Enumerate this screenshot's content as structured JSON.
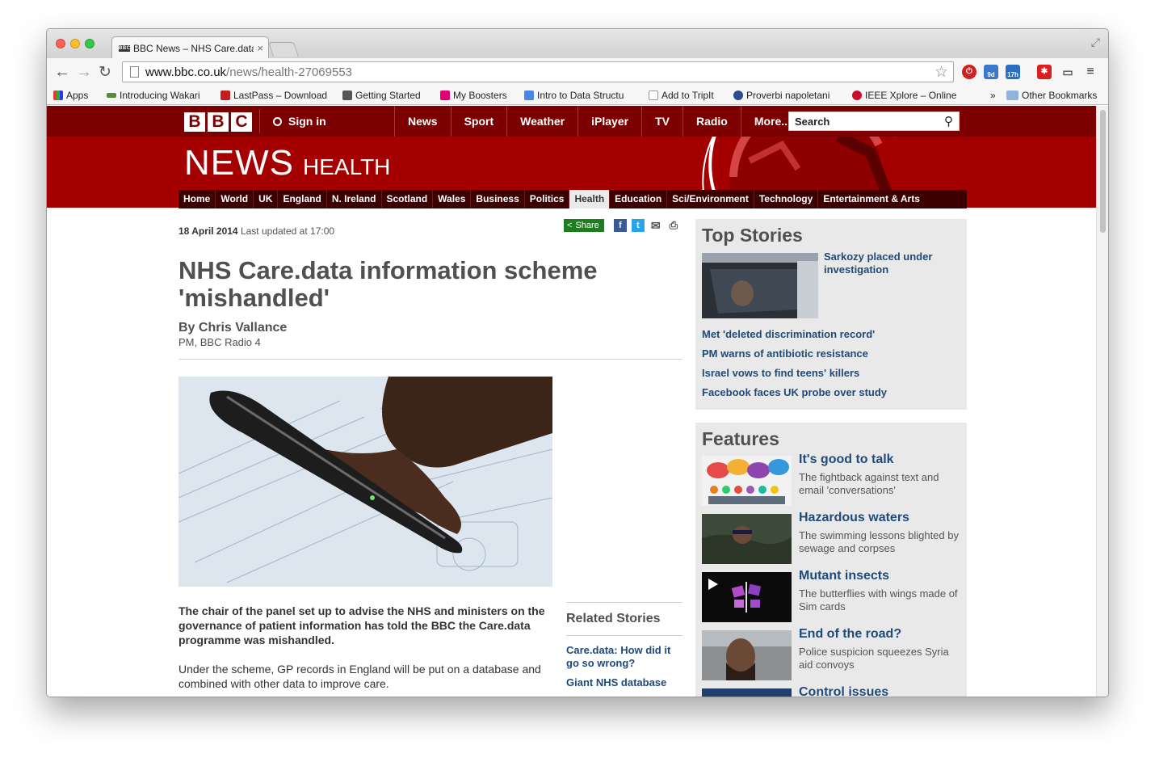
{
  "browser": {
    "tab_title": "BBC News – NHS Care.data",
    "url_host": "www.bbc.co.uk",
    "url_path": "/news/health-27069553",
    "bookmarks": [
      "Apps",
      "Introducing Wakari",
      "LastPass – Download",
      "Getting Started",
      "My Boosters",
      "Intro to Data Structu",
      "Add to TripIt",
      "Proverbi napoletani",
      "IEEE Xplore – Online"
    ],
    "overflow": "»",
    "other_bookmarks": "Other Bookmarks",
    "ext_badges": [
      "9d",
      "17h"
    ]
  },
  "bbc": {
    "sign_in": "Sign in",
    "top_nav": [
      "News",
      "Sport",
      "Weather",
      "iPlayer",
      "TV",
      "Radio",
      "More..."
    ],
    "search_placeholder": "Search",
    "masthead": "NEWS",
    "section": "HEALTH",
    "sub_nav": [
      "Home",
      "World",
      "UK",
      "England",
      "N. Ireland",
      "Scotland",
      "Wales",
      "Business",
      "Politics",
      "Health",
      "Education",
      "Sci/Environment",
      "Technology",
      "Entertainment & Arts"
    ],
    "active_section": "Health"
  },
  "article": {
    "date": "18 April 2014",
    "updated": "Last updated at 17:00",
    "share_label": "Share",
    "headline": "NHS Care.data information scheme 'mishandled'",
    "byline": "By Chris Vallance",
    "role": "PM, BBC Radio 4",
    "lead": "The chair of the panel set up to advise the NHS and ministers on the governance of patient information has told the BBC the Care.data programme was mishandled.",
    "para1": "Under the scheme, GP records in England will be put on a database and combined with other data to improve care."
  },
  "related": {
    "title": "Related Stories",
    "links": [
      "Care.data: How did it go so wrong?",
      "Giant NHS database"
    ]
  },
  "top_stories": {
    "title": "Top Stories",
    "lead": "Sarkozy placed under investigation",
    "links": [
      "Met 'deleted discrimination record'",
      "PM warns of antibiotic resistance",
      "Israel vows to find teens' killers",
      "Facebook faces UK probe over study"
    ]
  },
  "features": {
    "title": "Features",
    "items": [
      {
        "title": "It's good to talk",
        "desc": "The fightback against text and email 'conversations'"
      },
      {
        "title": "Hazardous waters",
        "desc": "The swimming lessons blighted by sewage and corpses"
      },
      {
        "title": "Mutant insects",
        "desc": "The butterflies with wings made of Sim cards"
      },
      {
        "title": "End of the road?",
        "desc": "Police suspicion squeezes Syria aid convoys"
      },
      {
        "title": "Control issues",
        "desc": ""
      }
    ]
  },
  "colors": {
    "bbc_dark_red": "#7d0000",
    "bbc_red": "#a50000",
    "link_blue": "#1f4a7a",
    "share_green": "#1e7d1e"
  }
}
